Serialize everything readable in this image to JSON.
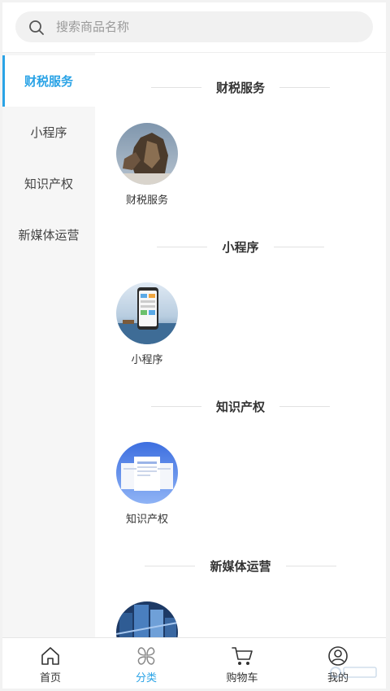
{
  "search": {
    "placeholder": "搜索商品名称"
  },
  "sidebar": {
    "items": [
      {
        "label": "财税服务",
        "active": true
      },
      {
        "label": "小程序",
        "active": false
      },
      {
        "label": "知识产权",
        "active": false
      },
      {
        "label": "新媒体运营",
        "active": false
      }
    ]
  },
  "sections": [
    {
      "title": "财税服务",
      "products": [
        {
          "label": "财税服务",
          "image": "sculpture-photo"
        }
      ]
    },
    {
      "title": "小程序",
      "products": [
        {
          "label": "小程序",
          "image": "phone-seascape-photo"
        }
      ]
    },
    {
      "title": "知识产权",
      "products": [
        {
          "label": "知识产权",
          "image": "document-cards-photo"
        }
      ]
    },
    {
      "title": "新媒体运营",
      "products": [
        {
          "label": "",
          "image": "city-buildings-photo"
        }
      ]
    }
  ],
  "tabbar": {
    "items": [
      {
        "label": "首页",
        "icon": "home-icon",
        "active": false
      },
      {
        "label": "分类",
        "icon": "category-icon",
        "active": true
      },
      {
        "label": "购物车",
        "icon": "cart-icon",
        "active": false
      },
      {
        "label": "我的",
        "icon": "user-icon",
        "active": false
      }
    ]
  },
  "colors": {
    "accent": "#2aa3e6",
    "sidebar_bg": "#f6f6f6",
    "search_bg": "#f1f1f1"
  }
}
